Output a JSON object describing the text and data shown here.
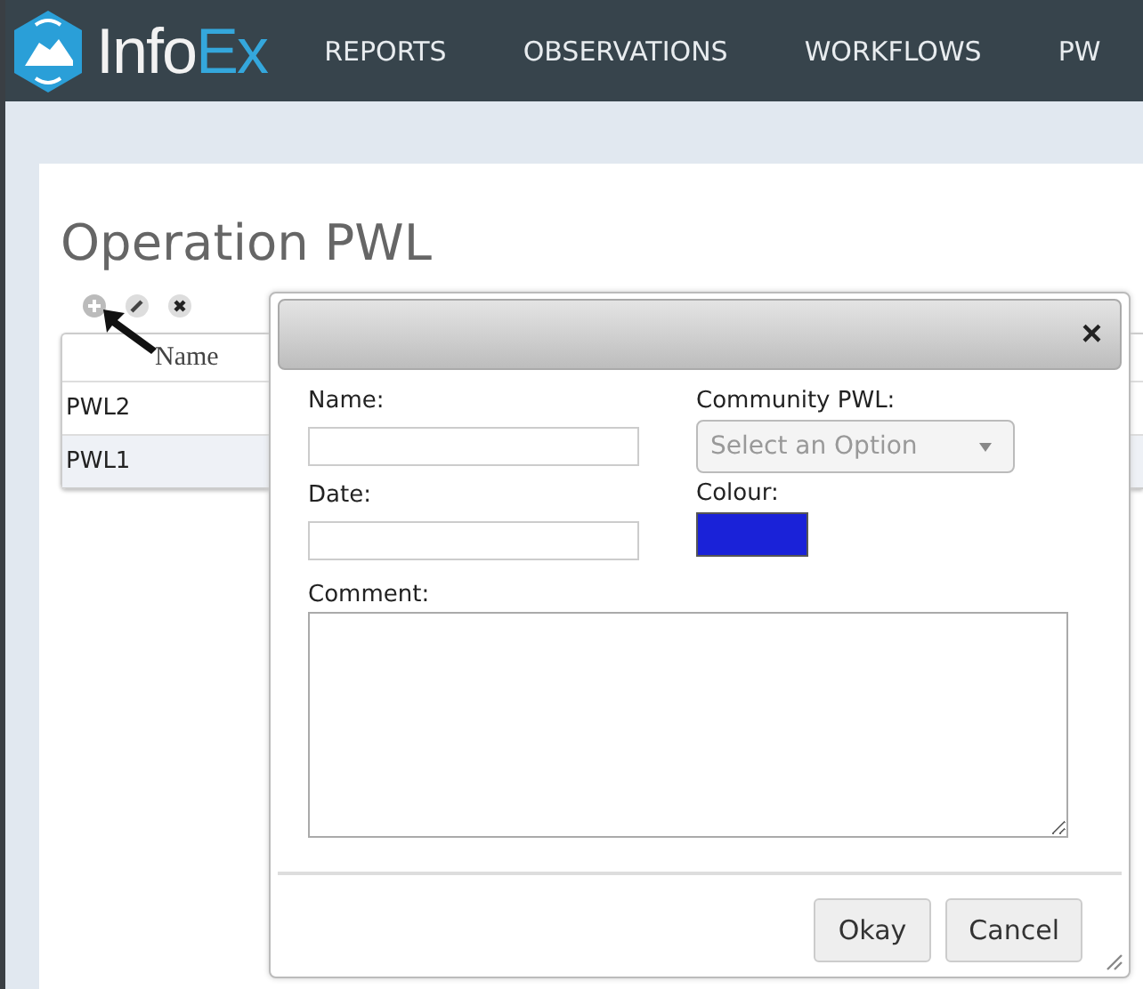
{
  "navbar": {
    "logo": [
      "Info",
      "Ex"
    ],
    "items": [
      {
        "label": "REPORTS"
      },
      {
        "label": "OBSERVATIONS"
      },
      {
        "label": "WORKFLOWS"
      },
      {
        "label": "PW"
      }
    ]
  },
  "page": {
    "title": "Operation PWL",
    "table": {
      "columns": [
        "Name"
      ],
      "rows": [
        {
          "cells": [
            "PWL2"
          ],
          "selected": false
        },
        {
          "cells": [
            "PWL1"
          ],
          "selected": true
        }
      ]
    }
  },
  "dialog": {
    "close": "×",
    "name": {
      "label": "Name:"
    },
    "date": {
      "label": "Date:"
    },
    "community": {
      "label": "Community PWL:",
      "placeholder": "Select an Option"
    },
    "colour": {
      "label": "Colour:",
      "color": "#1a22d8"
    },
    "comment": {
      "label": "Comment:"
    },
    "buttons": [
      "Okay",
      "Cancel"
    ]
  }
}
